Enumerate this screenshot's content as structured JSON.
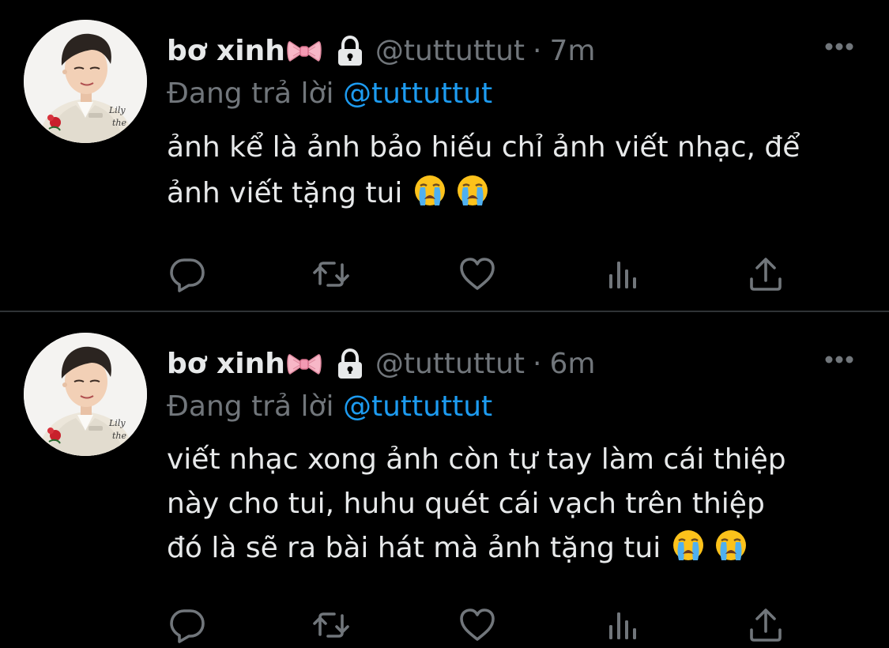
{
  "colors": {
    "background": "#000000",
    "primary_text": "#e7e9ea",
    "secondary_text": "#71767b",
    "accent_link": "#1d9bf0",
    "divider": "#2f3336"
  },
  "tweets": [
    {
      "display_name": "bơ xinh",
      "name_emoji": "ribbon-icon",
      "protected_icon": "lock-icon",
      "handle": "@tuttuttut",
      "separator": "·",
      "time": "7m",
      "reply_prefix": "Đang trả lời",
      "reply_to": "@tuttuttut",
      "text_lines": [
        "ảnh kể là ảnh bảo hiếu chỉ ảnh viết nhạc, để",
        "ảnh viết tặng tui"
      ],
      "trailing_emojis": [
        "loudly-crying-face-icon",
        "loudly-crying-face-icon"
      ],
      "actions": [
        "reply-icon",
        "retweet-icon",
        "heart-icon",
        "views-icon",
        "share-icon"
      ]
    },
    {
      "display_name": "bơ xinh",
      "name_emoji": "ribbon-icon",
      "protected_icon": "lock-icon",
      "handle": "@tuttuttut",
      "separator": "·",
      "time": "6m",
      "reply_prefix": "Đang trả lời",
      "reply_to": "@tuttuttut",
      "text_lines": [
        "viết nhạc xong ảnh còn tự tay làm cái thiệp",
        "này cho tui, huhu quét cái vạch trên thiệp",
        "đó là sẽ ra bài hát mà ảnh tặng tui"
      ],
      "trailing_emojis": [
        "loudly-crying-face-icon",
        "loudly-crying-face-icon"
      ],
      "actions": [
        "reply-icon",
        "retweet-icon",
        "heart-icon",
        "views-icon",
        "share-icon"
      ]
    }
  ]
}
